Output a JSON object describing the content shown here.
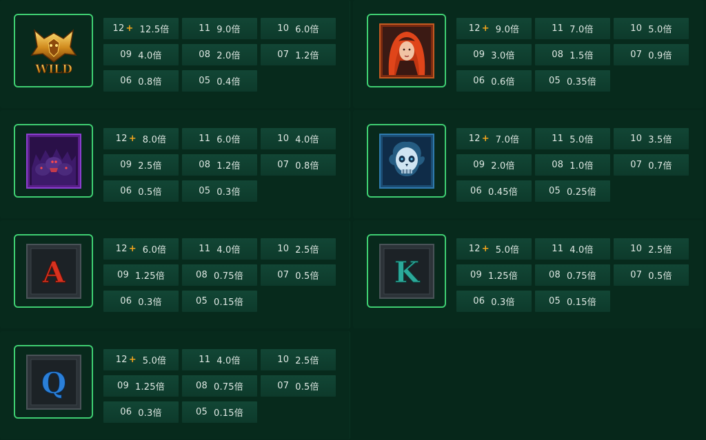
{
  "colors": {
    "background": "#06271a",
    "cell": "#124635",
    "symbol_border": "#3fcf72",
    "plus_accent": "#f4a61d"
  },
  "multiplier_suffix": "倍",
  "plus_sign": "+",
  "symbols": [
    {
      "name": "wild",
      "icon": "wild-symbol-icon",
      "icon_text": "WILD",
      "payouts": [
        {
          "count": "12",
          "plus": true,
          "value": "12.5倍"
        },
        {
          "count": "11",
          "value": "9.0倍"
        },
        {
          "count": "10",
          "value": "6.0倍"
        },
        {
          "count": "09",
          "value": "4.0倍"
        },
        {
          "count": "08",
          "value": "2.0倍"
        },
        {
          "count": "07",
          "value": "1.2倍"
        },
        {
          "count": "06",
          "value": "0.8倍"
        },
        {
          "count": "05",
          "value": "0.4倍"
        }
      ]
    },
    {
      "name": "red-haired-woman",
      "icon": "red-haired-woman-symbol-icon",
      "payouts": [
        {
          "count": "12",
          "plus": true,
          "value": "9.0倍"
        },
        {
          "count": "11",
          "value": "7.0倍"
        },
        {
          "count": "10",
          "value": "5.0倍"
        },
        {
          "count": "09",
          "value": "3.0倍"
        },
        {
          "count": "08",
          "value": "1.5倍"
        },
        {
          "count": "07",
          "value": "0.9倍"
        },
        {
          "count": "06",
          "value": "0.6倍"
        },
        {
          "count": "05",
          "value": "0.35倍"
        }
      ]
    },
    {
      "name": "three-headed-hound",
      "icon": "three-headed-hound-symbol-icon",
      "payouts": [
        {
          "count": "12",
          "plus": true,
          "value": "8.0倍"
        },
        {
          "count": "11",
          "value": "6.0倍"
        },
        {
          "count": "10",
          "value": "4.0倍"
        },
        {
          "count": "09",
          "value": "2.5倍"
        },
        {
          "count": "08",
          "value": "1.2倍"
        },
        {
          "count": "07",
          "value": "0.8倍"
        },
        {
          "count": "06",
          "value": "0.5倍"
        },
        {
          "count": "05",
          "value": "0.3倍"
        }
      ]
    },
    {
      "name": "blue-skull",
      "icon": "blue-skull-symbol-icon",
      "payouts": [
        {
          "count": "12",
          "plus": true,
          "value": "7.0倍"
        },
        {
          "count": "11",
          "value": "5.0倍"
        },
        {
          "count": "10",
          "value": "3.5倍"
        },
        {
          "count": "09",
          "value": "2.0倍"
        },
        {
          "count": "08",
          "value": "1.0倍"
        },
        {
          "count": "07",
          "value": "0.7倍"
        },
        {
          "count": "06",
          "value": "0.45倍"
        },
        {
          "count": "05",
          "value": "0.25倍"
        }
      ]
    },
    {
      "name": "letter-a",
      "icon": "letter-a-symbol-icon",
      "icon_text": "A",
      "payouts": [
        {
          "count": "12",
          "plus": true,
          "value": "6.0倍"
        },
        {
          "count": "11",
          "value": "4.0倍"
        },
        {
          "count": "10",
          "value": "2.5倍"
        },
        {
          "count": "09",
          "value": "1.25倍"
        },
        {
          "count": "08",
          "value": "0.75倍"
        },
        {
          "count": "07",
          "value": "0.5倍"
        },
        {
          "count": "06",
          "value": "0.3倍"
        },
        {
          "count": "05",
          "value": "0.15倍"
        }
      ]
    },
    {
      "name": "letter-k",
      "icon": "letter-k-symbol-icon",
      "icon_text": "K",
      "payouts": [
        {
          "count": "12",
          "plus": true,
          "value": "5.0倍"
        },
        {
          "count": "11",
          "value": "4.0倍"
        },
        {
          "count": "10",
          "value": "2.5倍"
        },
        {
          "count": "09",
          "value": "1.25倍"
        },
        {
          "count": "08",
          "value": "0.75倍"
        },
        {
          "count": "07",
          "value": "0.5倍"
        },
        {
          "count": "06",
          "value": "0.3倍"
        },
        {
          "count": "05",
          "value": "0.15倍"
        }
      ]
    },
    {
      "name": "letter-q",
      "icon": "letter-q-symbol-icon",
      "icon_text": "Q",
      "payouts": [
        {
          "count": "12",
          "plus": true,
          "value": "5.0倍"
        },
        {
          "count": "11",
          "value": "4.0倍"
        },
        {
          "count": "10",
          "value": "2.5倍"
        },
        {
          "count": "09",
          "value": "1.25倍"
        },
        {
          "count": "08",
          "value": "0.75倍"
        },
        {
          "count": "07",
          "value": "0.5倍"
        },
        {
          "count": "06",
          "value": "0.3倍"
        },
        {
          "count": "05",
          "value": "0.15倍"
        }
      ]
    }
  ]
}
